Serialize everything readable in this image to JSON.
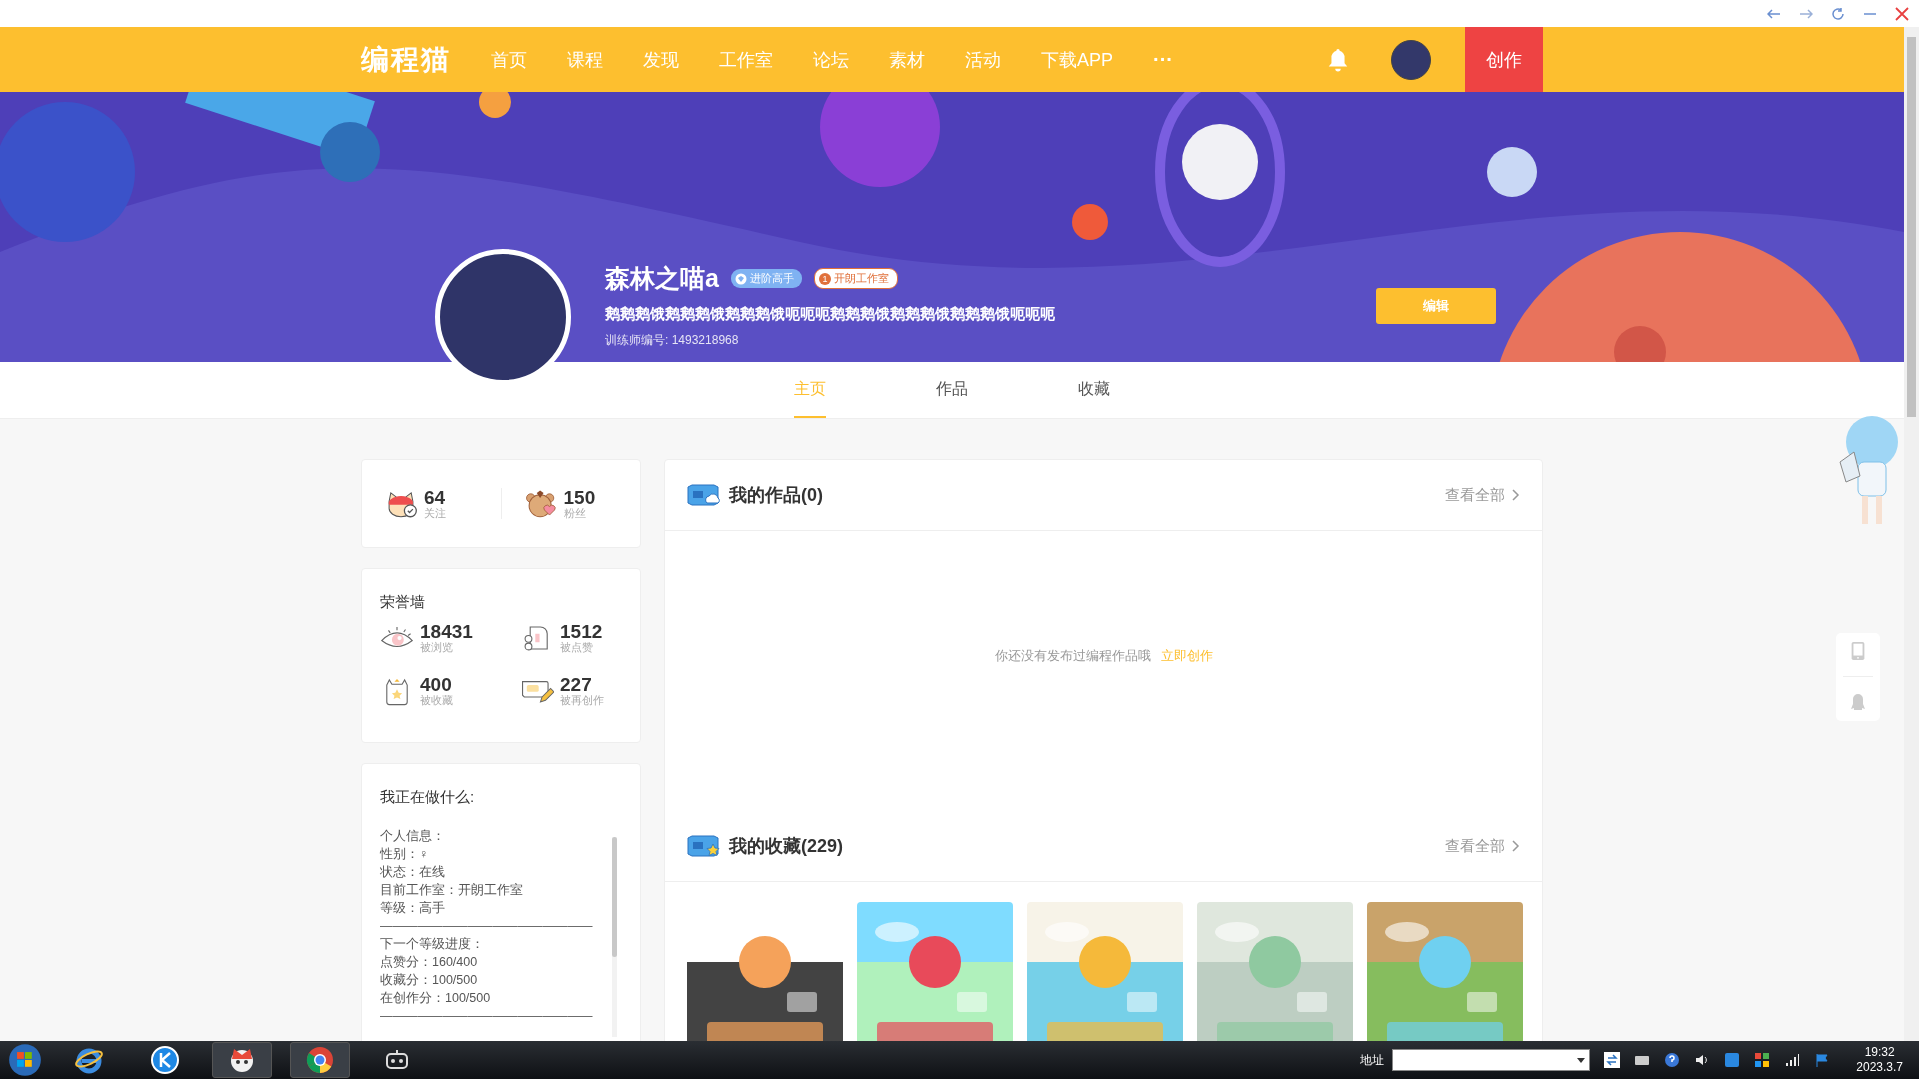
{
  "nav": {
    "logo": "编程猫",
    "items": [
      "首页",
      "课程",
      "发现",
      "工作室",
      "论坛",
      "素材",
      "活动",
      "下载APP"
    ],
    "more": "···",
    "create": "创作"
  },
  "profile": {
    "name": "森林之喵a",
    "badges": [
      {
        "kind": "level",
        "label": "进阶高手"
      },
      {
        "kind": "studio",
        "rank": "1",
        "label": "开朗工作室"
      }
    ],
    "motto": "鹅鹅鹅饿鹅鹅鹅饿鹅鹅鹅饿呃呃呃鹅鹅鹅饿鹅鹅鹅饿鹅鹅鹅饿呃呃呃",
    "trainer_id": "训练师编号: 1493218968",
    "edit": "编辑"
  },
  "tabs": [
    {
      "label": "主页",
      "selected": true
    },
    {
      "label": "作品",
      "selected": false
    },
    {
      "label": "收藏",
      "selected": false
    }
  ],
  "follow_stats": [
    {
      "kind": "follow",
      "value": "64",
      "label": "关注"
    },
    {
      "kind": "fans",
      "value": "150",
      "label": "粉丝"
    }
  ],
  "honor": {
    "title": "荣誉墙",
    "items": [
      {
        "kind": "views",
        "value": "18431",
        "label": "被浏览"
      },
      {
        "kind": "likes",
        "value": "1512",
        "label": "被点赞"
      },
      {
        "kind": "collects",
        "value": "400",
        "label": "被收藏"
      },
      {
        "kind": "remix",
        "value": "227",
        "label": "被再创作"
      }
    ]
  },
  "status": {
    "title": "我正在做什么:",
    "lines": [
      "个人信息：",
      "性别：♀",
      "状态：在线",
      "目前工作室：开朗工作室",
      "等级：高手",
      "—————————————————",
      "下一个等级进度：",
      "点赞分：160/400",
      "收藏分：100/500",
      "在创作分：100/500",
      "—————————————————"
    ]
  },
  "works": {
    "title": "我的作品(0)",
    "view_all": "查看全部",
    "empty_text": "你还没有发布过编程作品哦",
    "create_link": "立即创作"
  },
  "favorites": {
    "title": "我的收藏(229)",
    "view_all": "查看全部"
  },
  "taskbar": {
    "address_label": "地址",
    "time": "19:32",
    "date": "2023.3.7"
  }
}
